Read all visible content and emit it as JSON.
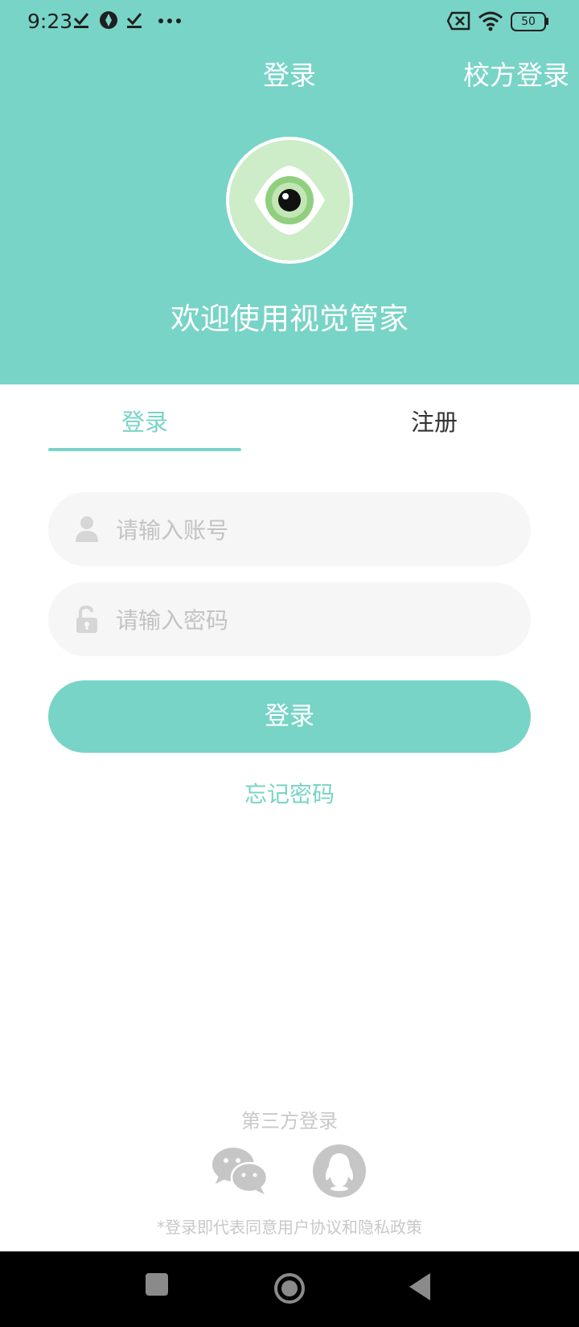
{
  "status_bar": {
    "time": "9:23",
    "battery": "50"
  },
  "nav": {
    "title": "登录",
    "school_login": "校方登录"
  },
  "header": {
    "welcome": "欢迎使用视觉管家"
  },
  "tabs": {
    "login": "登录",
    "register": "注册"
  },
  "form": {
    "account_placeholder": "请输入账号",
    "password_placeholder": "请输入密码",
    "login_button": "登录",
    "forgot": "忘记密码"
  },
  "third_party": {
    "title": "第三方登录",
    "agreement": "*登录即代表同意用户协议和隐私政策"
  },
  "colors": {
    "accent": "#78d4c6"
  },
  "icons": [
    "user-icon",
    "lock-icon",
    "wechat-icon",
    "qq-icon",
    "eye-logo"
  ]
}
